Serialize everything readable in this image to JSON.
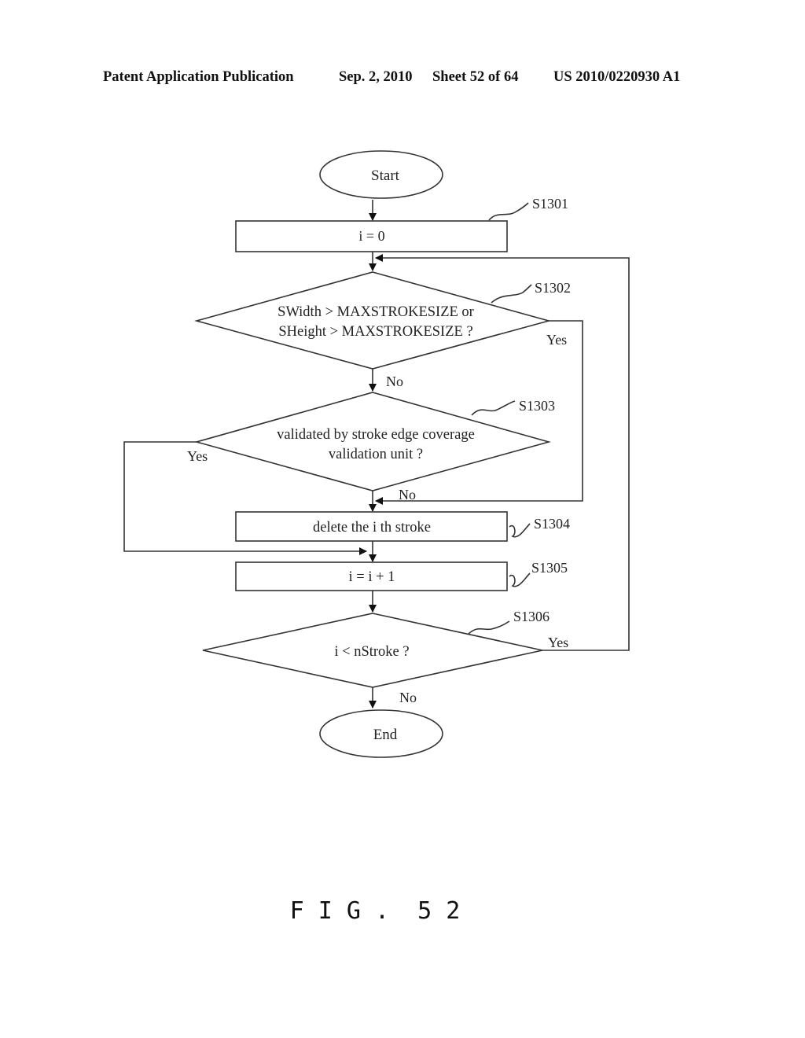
{
  "header": {
    "publication": "Patent Application Publication",
    "date": "Sep. 2, 2010",
    "sheet": "Sheet 52 of 64",
    "number": "US 2010/0220930 A1"
  },
  "flowchart": {
    "start": "Start",
    "end": "End",
    "steps": {
      "s1301": {
        "id": "S1301",
        "text": "i = 0"
      },
      "s1302": {
        "id": "S1302",
        "line1": "SWidth > MAXSTROKESIZE or",
        "line2": "SHeight > MAXSTROKESIZE ?"
      },
      "s1303": {
        "id": "S1303",
        "line1": "validated by stroke edge coverage",
        "line2": "validation unit ?"
      },
      "s1304": {
        "id": "S1304",
        "text": "delete the i th stroke"
      },
      "s1305": {
        "id": "S1305",
        "text": "i = i + 1"
      },
      "s1306": {
        "id": "S1306",
        "text": "i < nStroke ?"
      }
    },
    "branches": {
      "s1302_yes": "Yes",
      "s1302_no": "No",
      "s1303_yes": "Yes",
      "s1303_no": "No",
      "s1306_yes": "Yes",
      "s1306_no": "No"
    }
  },
  "figure_label": "F I G .  5 2"
}
